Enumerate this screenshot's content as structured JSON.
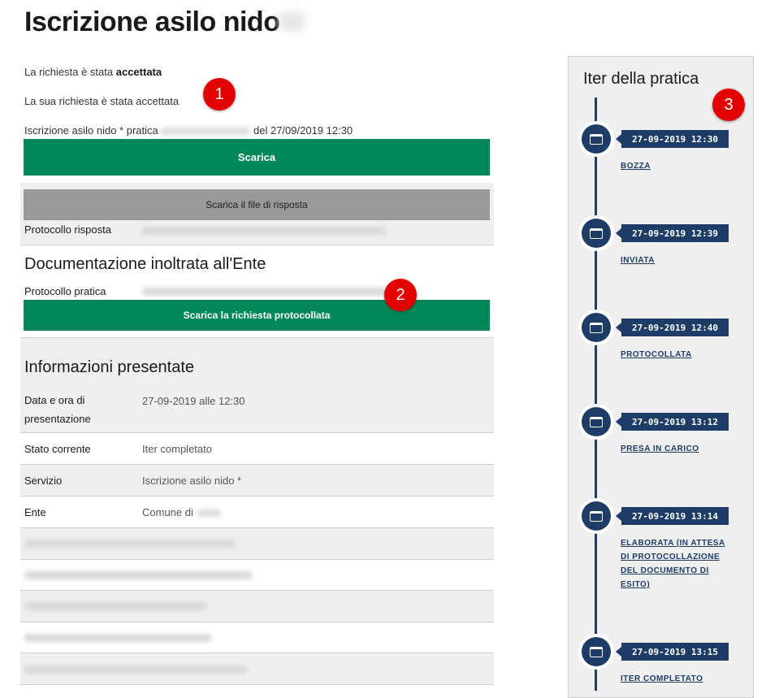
{
  "page": {
    "title": "Iscrizione asilo nido"
  },
  "status": {
    "accepted_prefix": "La richiesta è stata ",
    "accepted_word": "accettata",
    "message": "La sua richiesta è stata accettata",
    "pratica_prefix": "Iscrizione asilo nido * pratica",
    "pratica_suffix": "del 27/09/2019 12:30"
  },
  "buttons": {
    "download": "Scarica",
    "download_response": "Scarica il file di risposta",
    "download_protocol": "Scarica la richiesta protocollata"
  },
  "response": {
    "protocol_label": "Protocollo risposta"
  },
  "documentation": {
    "title": "Documentazione inoltrata all'Ente",
    "protocol_label": "Protocollo pratica"
  },
  "info": {
    "title": "Informazioni presentate",
    "rows": [
      {
        "label": "Data e ora di presentazione",
        "value": "27-09-2019 alle 12:30"
      },
      {
        "label": "Stato corrente",
        "value": "Iter completato"
      },
      {
        "label": "Servizio",
        "value": "Iscrizione asilo nido *"
      },
      {
        "label": "Ente",
        "value": "Comune di"
      }
    ]
  },
  "badges": [
    "1",
    "2",
    "3"
  ],
  "timeline": {
    "title": "Iter della pratica",
    "icon": "calendar-icon",
    "color": "#1d3d66",
    "steps": [
      {
        "date": "27-09-2019 12:30",
        "label": "BOZZA"
      },
      {
        "date": "27-09-2019 12:39",
        "label": "INVIATA"
      },
      {
        "date": "27-09-2019 12:40",
        "label": "PROTOCOLLATA"
      },
      {
        "date": "27-09-2019 13:12",
        "label": "PRESA IN CARICO"
      },
      {
        "date": "27-09-2019 13:14",
        "label": "ELABORATA (IN ATTESA DI PROTOCOLLAZIONE DEL DOCUMENTO DI ESITO)"
      },
      {
        "date": "27-09-2019 13:15",
        "label": "ITER COMPLETATO"
      }
    ]
  },
  "colors": {
    "primary_green": "#008758",
    "grey_button": "#999999",
    "badge_red": "#e30000"
  }
}
